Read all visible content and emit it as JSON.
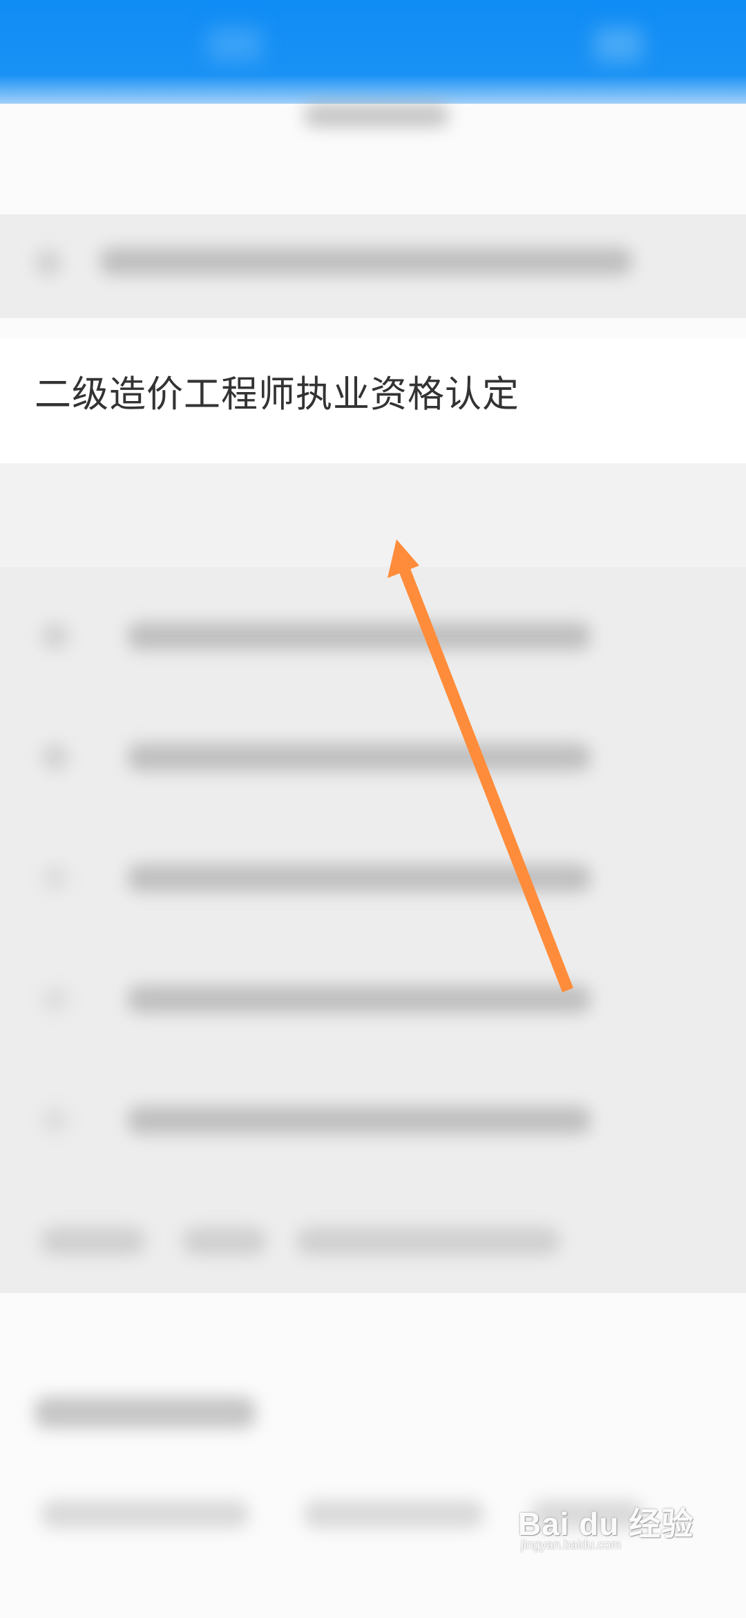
{
  "focus_item": {
    "label": "二级造价工程师执业资格认定"
  },
  "annotation": {
    "arrow_color": "#ff8c3a"
  },
  "watermark": {
    "brand": "Bai du 经验",
    "url": "jingyan.baidu.com"
  },
  "colors": {
    "header_blue": "#0f8cf5",
    "text": "#333333"
  }
}
